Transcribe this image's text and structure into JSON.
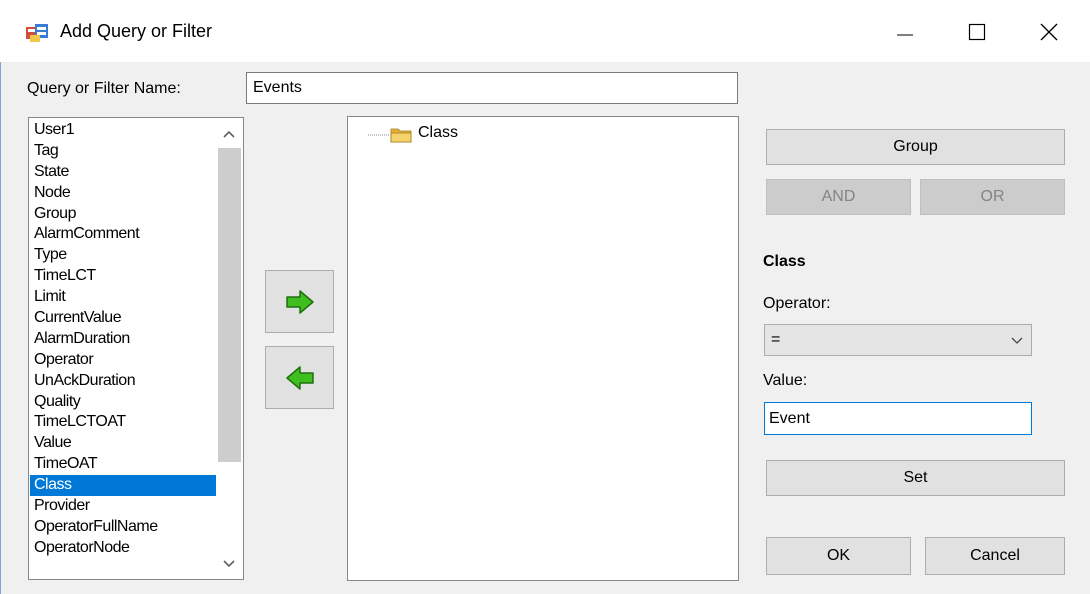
{
  "window": {
    "title": "Add Query or Filter",
    "icon": "form-app-icon",
    "controls": {
      "minimize": "minimize-icon",
      "maximize": "maximize-icon",
      "close": "close-icon"
    }
  },
  "name_field": {
    "label": "Query or Filter Name:",
    "value": "Events"
  },
  "field_list": {
    "items": [
      "User1",
      "Tag",
      "State",
      "Node",
      "Group",
      "AlarmComment",
      "Type",
      "TimeLCT",
      "Limit",
      "CurrentValue",
      "AlarmDuration",
      "Operator",
      "UnAckDuration",
      "Quality",
      "TimeLCTOAT",
      "Value",
      "TimeOAT",
      "Class",
      "Provider",
      "OperatorFullName",
      "OperatorNode"
    ],
    "selected": "Class"
  },
  "transfer": {
    "add_icon": "green-right-arrow-icon",
    "remove_icon": "green-left-arrow-icon"
  },
  "tree": {
    "root_label": "Class",
    "root_icon": "folder-icon"
  },
  "actions": {
    "group": "Group",
    "and": "AND",
    "or": "OR"
  },
  "condition": {
    "title": "Class",
    "operator_label": "Operator:",
    "operator_value": "=",
    "value_label": "Value:",
    "value": "Event",
    "set": "Set"
  },
  "footer": {
    "ok": "OK",
    "cancel": "Cancel"
  },
  "colors": {
    "selection": "#0078d7",
    "arrow_green": "#3fbf1f",
    "folder": "#f2c84b"
  }
}
